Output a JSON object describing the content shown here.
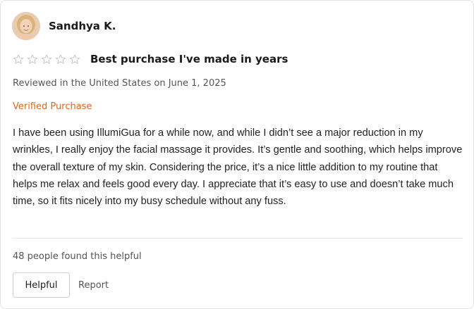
{
  "reviewer": {
    "name": "Sandhya K.",
    "avatar_icon": "avatar-photo"
  },
  "review": {
    "rating": 0,
    "rating_max": 5,
    "star_color": "#c8c8c8",
    "title": "Best purchase I've made in years",
    "meta": "Reviewed in the United States on June 1, 2025",
    "verified_label": "Verified Purchase",
    "verified_color": "#e0661a",
    "body": "I have been using IllumiGua for a while now, and while I didn’t see a major reduction in my wrinkles, I really enjoy the facial massage it provides. It’s gentle and soothing, which helps improve the overall texture of my skin. Considering the price, it’s a nice little addition to my routine that helps me relax and feels good every day. I appreciate that it’s easy to use and doesn’t take much time, so it fits nicely into my busy schedule without any fuss."
  },
  "footer": {
    "helpful_count_text": "48 people found this helpful",
    "helpful_button": "Helpful",
    "report_link": "Report"
  }
}
